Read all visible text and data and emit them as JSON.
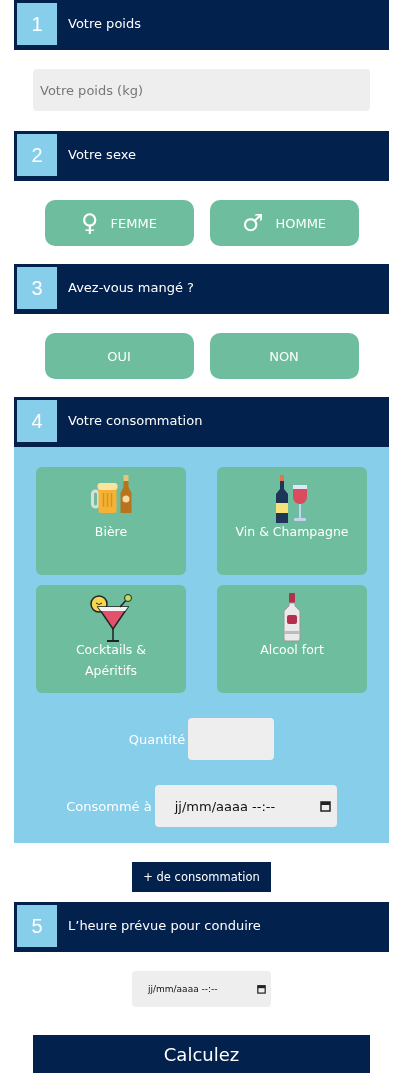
{
  "sections": [
    {
      "number": "1",
      "title": "Votre poids",
      "kind": "weight",
      "field": {
        "placeholder": "Votre poids (kg)"
      }
    },
    {
      "number": "2",
      "title": "Votre sexe",
      "kind": "choices",
      "options": [
        {
          "label": "FEMME",
          "symbol": "♀",
          "selected": false
        },
        {
          "label": "HOMME",
          "symbol": "♂",
          "selected": false
        }
      ]
    },
    {
      "number": "3",
      "title": "Avez-vous mangé ?",
      "kind": "choices",
      "options": [
        {
          "label": "OUI",
          "selected": false
        },
        {
          "label": "NON",
          "selected": false
        }
      ]
    },
    {
      "number": "4",
      "title": "Votre consommation",
      "kind": "consumption",
      "drinks": [
        {
          "label": "Bière",
          "kind": "beer",
          "selected": false
        },
        {
          "label": "Vin & Champagne",
          "kind": "wine",
          "selected": false
        },
        {
          "label": "Cocktails & Apéritifs",
          "kind": "cocktail",
          "selected": false
        },
        {
          "label": "Alcool fort",
          "kind": "spirits",
          "selected": false
        }
      ],
      "quantity_label": "Quantité",
      "consumed_label": "Consommé à",
      "consumed_field": {
        "value": "jj/mm/aaaa --:--"
      },
      "add_button": "+ de consommation"
    },
    {
      "number": "5",
      "title": "L’heure prévue pour conduire",
      "kind": "drive",
      "field": {
        "value": "jj/mm/aaaa --:--"
      }
    }
  ],
  "submit": "Calculez"
}
